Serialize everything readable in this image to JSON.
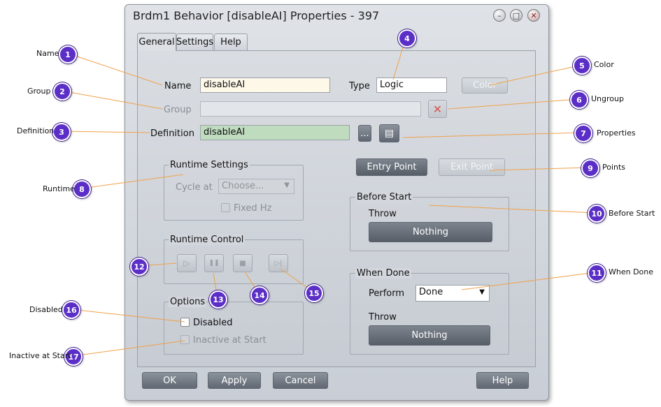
{
  "window": {
    "title": "Brdm1 Behavior [disableAI] Properties - 397",
    "minimize_glyph": "–",
    "maximize_glyph": "□",
    "close_glyph": "✕"
  },
  "tabs": [
    {
      "label": "General",
      "active": true
    },
    {
      "label": "Settings",
      "active": false
    },
    {
      "label": "Help",
      "active": false
    }
  ],
  "general": {
    "name_label": "Name",
    "name_value": "disableAI",
    "type_label": "Type",
    "type_value": "Logic",
    "color_button": "Color",
    "group_label": "Group",
    "group_value": "",
    "ungroup_glyph": "✕",
    "definition_label": "Definition",
    "definition_value": "disableAI",
    "browse_button": "...",
    "properties_glyph": "▤"
  },
  "runtime_settings": {
    "title": "Runtime Settings",
    "cycle_label": "Cycle at",
    "cycle_placeholder": "Choose...",
    "cycle_arrow": "▼",
    "fixed_hz_label": "Fixed Hz"
  },
  "runtime_control": {
    "title": "Runtime Control",
    "play_glyph": "▷",
    "pause_glyph": "❚❚",
    "stop_glyph": "■",
    "step_glyph": "▷|"
  },
  "options": {
    "title": "Options",
    "disabled_label": "Disabled",
    "inactive_label": "Inactive at Start"
  },
  "points": {
    "entry_button": "Entry Point",
    "exit_button": "Exit Point"
  },
  "before_start": {
    "title": "Before Start",
    "throw_label": "Throw",
    "throw_value": "Nothing"
  },
  "when_done": {
    "title": "When Done",
    "perform_label": "Perform",
    "perform_value": "Done",
    "perform_arrow": "▼",
    "throw_label": "Throw",
    "throw_value": "Nothing"
  },
  "footer": {
    "ok": "OK",
    "apply": "Apply",
    "cancel": "Cancel",
    "help": "Help"
  },
  "callouts": {
    "accent_color": "#5b2fc7",
    "line_color": "#f0a048",
    "items": [
      {
        "num": "1",
        "text": "Name"
      },
      {
        "num": "2",
        "text": "Group"
      },
      {
        "num": "3",
        "text": "Definition"
      },
      {
        "num": "4",
        "text": ""
      },
      {
        "num": "5",
        "text": "Color"
      },
      {
        "num": "6",
        "text": "Ungroup"
      },
      {
        "num": "7",
        "text": "Properties"
      },
      {
        "num": "8",
        "text": "Runtime"
      },
      {
        "num": "9",
        "text": "Points"
      },
      {
        "num": "10",
        "text": "Before Start"
      },
      {
        "num": "11",
        "text": "When Done"
      },
      {
        "num": "12",
        "text": ""
      },
      {
        "num": "13",
        "text": ""
      },
      {
        "num": "14",
        "text": ""
      },
      {
        "num": "15",
        "text": ""
      },
      {
        "num": "16",
        "text": "Disabled"
      },
      {
        "num": "17",
        "text": "Inactive at Start"
      }
    ]
  }
}
